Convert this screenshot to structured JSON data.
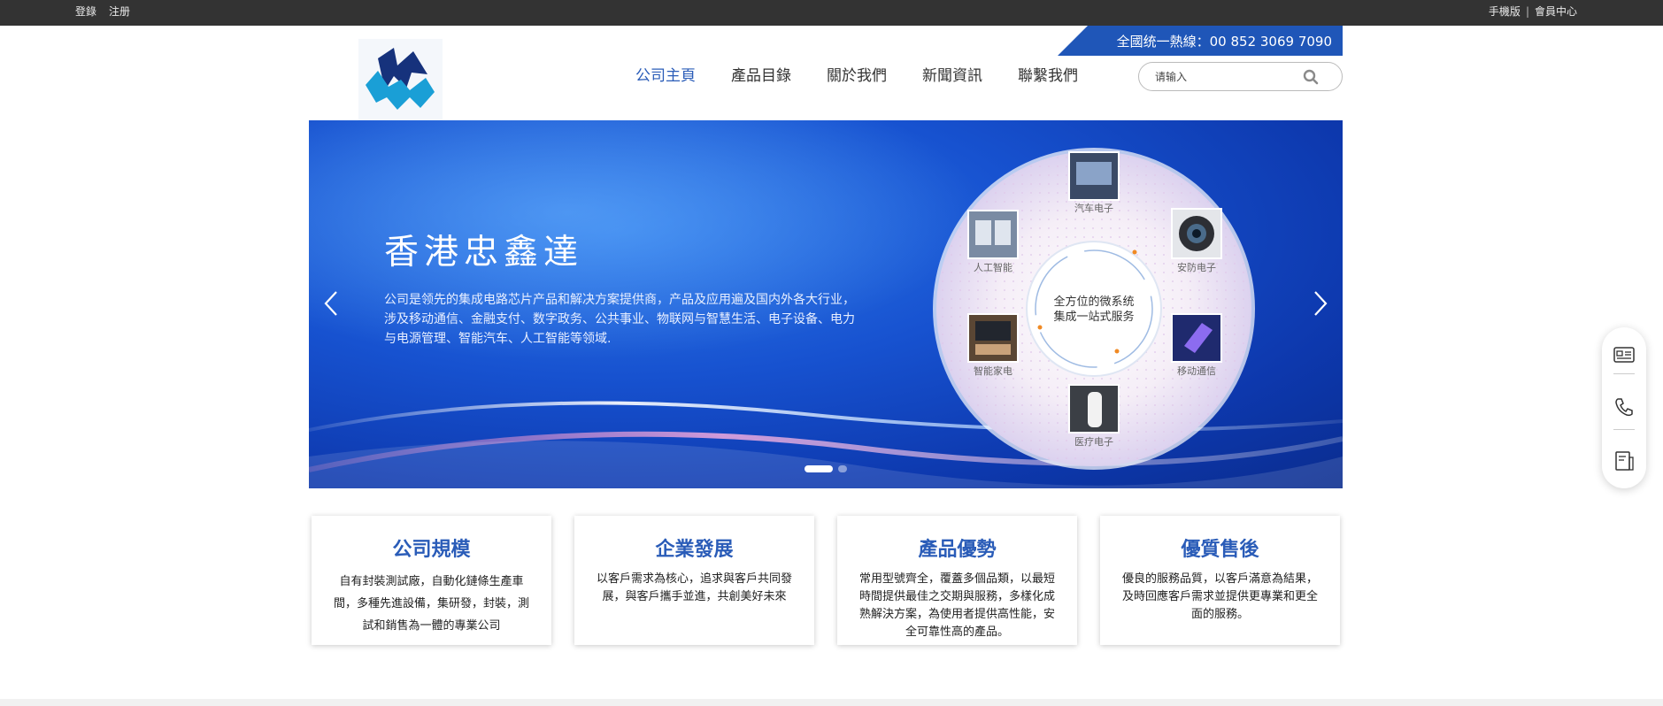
{
  "topbar": {
    "login": "登錄",
    "register": "注册",
    "mobile": "手機版",
    "member": "會員中心",
    "separator": "|"
  },
  "nav": [
    "公司主頁",
    "產品目錄",
    "關於我們",
    "新聞資訊",
    "聯繫我們"
  ],
  "hotline": "全國统一熱線：00 852 3069 7090",
  "search": {
    "placeholder": "请输入",
    "icon": "search-icon"
  },
  "banner": {
    "title": "香港忠鑫達",
    "desc": "公司是领先的集成电路芯片产品和解决方案提供商，产品及应用遍及国内外各大行业，涉及移动通信、金融支付、数字政务、公共事业、物联网与智慧生活、电子设备、电力与电源管理、智能汽车、人工智能等领域.",
    "wheel_center_1": "全方位的微系统",
    "wheel_center_2": "集成一站式服务",
    "wheel_items": [
      "汽车电子",
      "人工智能",
      "安防电子",
      "智能家电",
      "移动通信",
      "医疗电子"
    ],
    "slide_count": 2,
    "active_slide": 1
  },
  "sidebar_icons": [
    "card-icon",
    "phone-icon",
    "document-icon"
  ],
  "cards": [
    {
      "title": "公司規模",
      "text": "自有封裝測試廠，自動化鏈條生產車間，多種先進設備，集研發，封裝，測試和銷售為一體的專業公司"
    },
    {
      "title": "企業發展",
      "text": "以客戶需求為核心，追求與客戶共同發展，與客戶攜手並進，共創美好未來"
    },
    {
      "title": "產品優勢",
      "text": "常用型號齊全，覆蓋多個品類，以最短時間提供最佳之交期與服務，多樣化成熟解決方案，為使用者提供高性能，安全可靠性高的產品。"
    },
    {
      "title": "優質售後",
      "text": "優良的服務品質，以客戶滿意為結果，及時回應客戶需求並提供更專業和更全面的服務。"
    }
  ],
  "colors": {
    "accent": "#2a5cb8",
    "topbar": "#333333",
    "hotline": "#1f56b8"
  }
}
